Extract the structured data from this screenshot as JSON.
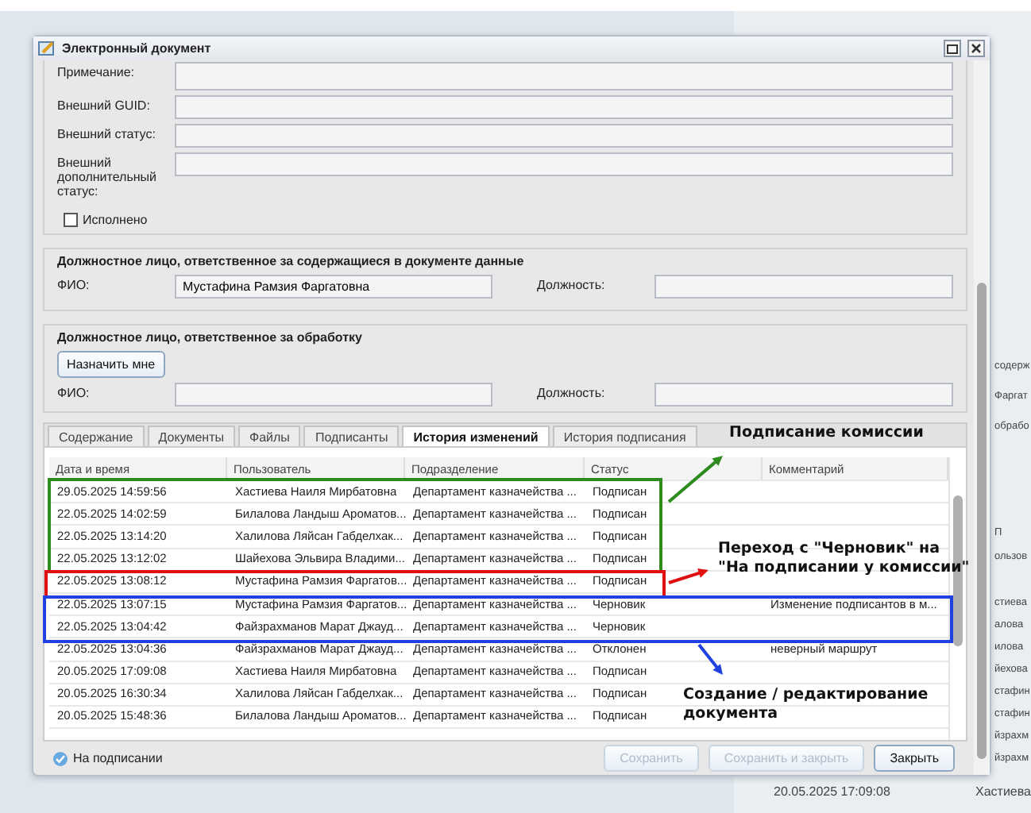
{
  "background": {
    "side_groups": [
      [
        "содерж",
        "Фаргат",
        "обрабо"
      ],
      [
        "П",
        "ользов"
      ],
      [
        "стиева",
        "алова",
        "илова",
        "йехова",
        "стафин",
        "стафин",
        "йзрахм",
        "йзрахм"
      ]
    ],
    "bottom": [
      "20.05.2025 17:09:08",
      "Хастиева"
    ]
  },
  "window": {
    "title": "Электронный документ"
  },
  "fields": [
    {
      "label": "Примечание:",
      "kind": "textarea"
    },
    {
      "label": "Внешний GUID:",
      "kind": "text"
    },
    {
      "label": "Внешний статус:",
      "kind": "text"
    },
    {
      "label": "Внешний дополнительный статус:",
      "kind": "text"
    }
  ],
  "checkbox": {
    "label": "Исполнено",
    "checked": false
  },
  "responsible_data": {
    "title": "Должностное лицо, ответственное за содержащиеся в документе данные",
    "fio_label": "ФИО:",
    "fio": "Мустафина Рамзия Фаргатовна",
    "position_label": "Должность:"
  },
  "responsible_processing": {
    "title": "Должностное лицо, ответственное за обработку",
    "assign_button": "Назначить мне",
    "fio_label": "ФИО:",
    "position_label": "Должность:"
  },
  "tabs": [
    {
      "label": "Содержание",
      "selected": false
    },
    {
      "label": "Документы",
      "selected": false
    },
    {
      "label": "Файлы",
      "selected": false
    },
    {
      "label": "Подписанты",
      "selected": false
    },
    {
      "label": "История изменений",
      "selected": true
    },
    {
      "label": "История подписания",
      "selected": false
    }
  ],
  "table": {
    "columns": [
      "Дата и время",
      "Пользователь",
      "Подразделение",
      "Статус",
      "Комментарий"
    ],
    "rows": [
      [
        "29.05.2025 14:59:56",
        "Хастиева Наиля Мирбатовна",
        "Департамент казначейства ...",
        "Подписан",
        ""
      ],
      [
        "22.05.2025 14:02:59",
        "Билалова Ландыш Ароматов...",
        "Департамент казначейства ...",
        "Подписан",
        ""
      ],
      [
        "22.05.2025 13:14:20",
        "Халилова Ляйсан Габделхак...",
        "Департамент казначейства ...",
        "Подписан",
        ""
      ],
      [
        "22.05.2025 13:12:02",
        "Шайехова Эльвира Владими...",
        "Департамент казначейства ...",
        "Подписан",
        ""
      ],
      [
        "22.05.2025 13:08:12",
        "Мустафина Рамзия Фаргатов...",
        "Департамент казначейства ...",
        "Подписан",
        ""
      ],
      [
        "22.05.2025 13:07:15",
        "Мустафина Рамзия Фаргатов...",
        "Департамент казначейства ...",
        "Черновик",
        "Изменение подписантов в м..."
      ],
      [
        "22.05.2025 13:04:42",
        "Файзрахманов Марат Джауд...",
        "Департамент казначейства ...",
        "Черновик",
        ""
      ],
      [
        "22.05.2025 13:04:36",
        "Файзрахманов Марат Джауд...",
        "Департамент казначейства ...",
        "Отклонен",
        "неверный маршрут"
      ],
      [
        "20.05.2025 17:09:08",
        "Хастиева Наиля Мирбатовна",
        "Департамент казначейства ...",
        "Подписан",
        ""
      ],
      [
        "20.05.2025 16:30:34",
        "Халилова Ляйсан Габделхак...",
        "Департамент казначейства ...",
        "Подписан",
        ""
      ],
      [
        "20.05.2025 15:48:36",
        "Билалова Ландыш Ароматов...",
        "Департамент казначейства ...",
        "Подписан",
        ""
      ]
    ]
  },
  "status": "На подписании",
  "buttons": [
    {
      "label": "Сохранить",
      "disabled": true
    },
    {
      "label": "Сохранить и закрыть",
      "disabled": true
    },
    {
      "label": "Закрыть",
      "disabled": false
    }
  ],
  "annotations": [
    {
      "kind": "green",
      "text": [
        "Подписание комиссии"
      ]
    },
    {
      "kind": "red",
      "text": [
        "Переход с \"Черновик\" на",
        "\"На подписании у комиссии\""
      ]
    },
    {
      "kind": "blue",
      "text": [
        "Создание / редактирование",
        "документа"
      ]
    }
  ]
}
